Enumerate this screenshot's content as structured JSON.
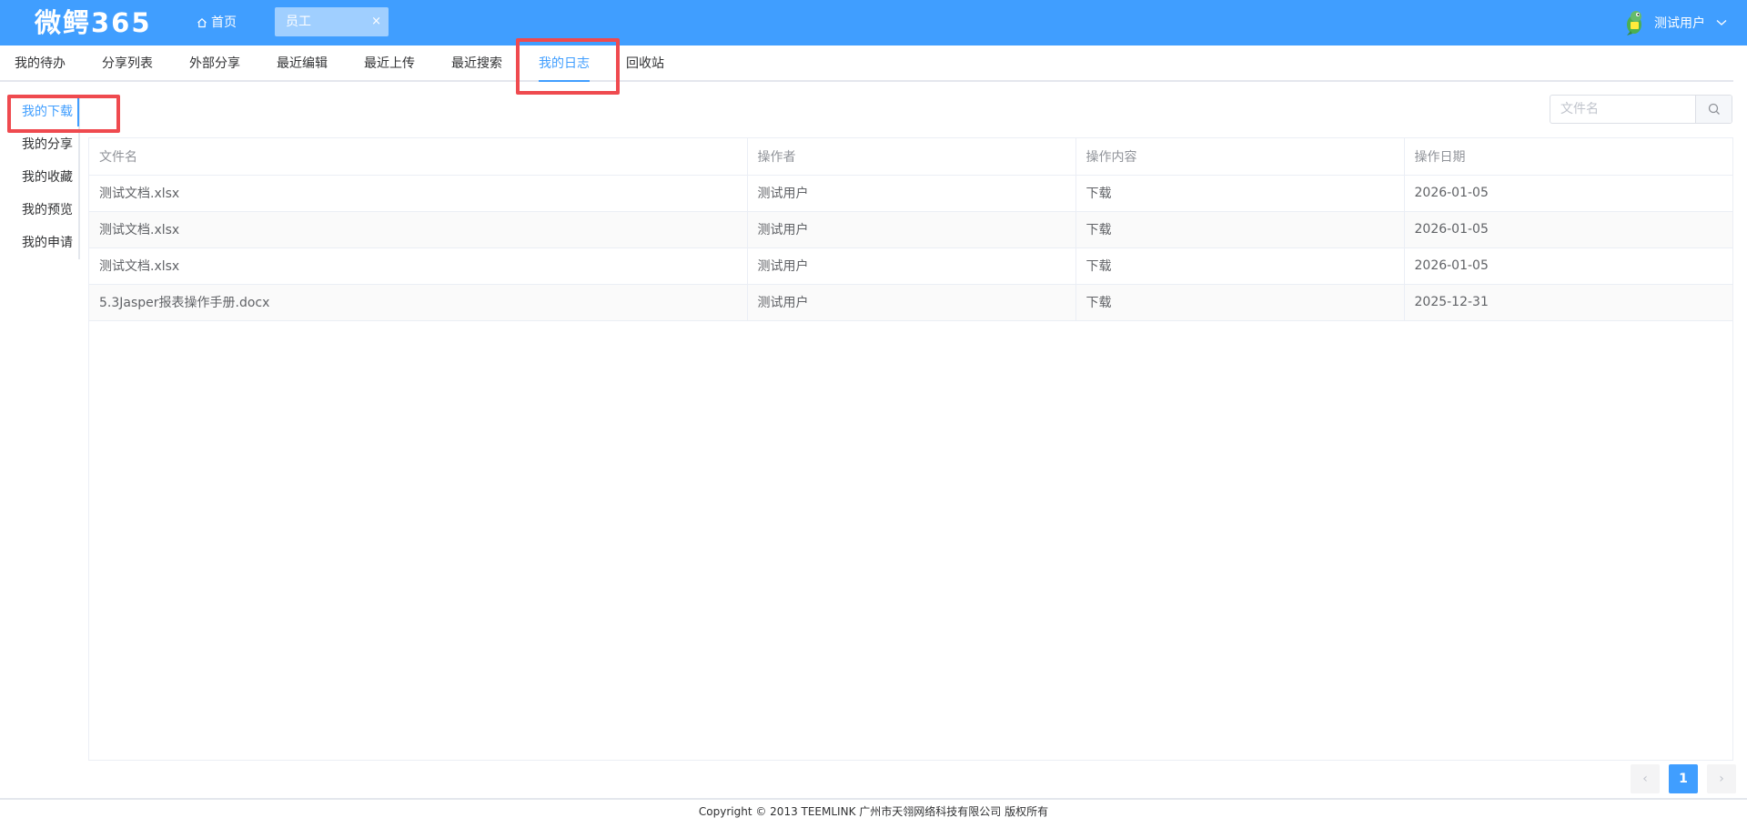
{
  "header": {
    "logo": "微鳄365",
    "home_label": "首页",
    "open_tab": {
      "label": "员工",
      "close": "×"
    },
    "user": {
      "name": "测试用户"
    },
    "bg_color": "#409eff"
  },
  "tabs": [
    {
      "label": "我的待办"
    },
    {
      "label": "分享列表"
    },
    {
      "label": "外部分享"
    },
    {
      "label": "最近编辑"
    },
    {
      "label": "最近上传"
    },
    {
      "label": "最近搜索"
    },
    {
      "label": "我的日志",
      "active": true
    },
    {
      "label": "回收站"
    }
  ],
  "side_menu": [
    {
      "label": "我的下载",
      "active": true
    },
    {
      "label": "我的分享"
    },
    {
      "label": "我的收藏"
    },
    {
      "label": "我的预览"
    },
    {
      "label": "我的申请"
    }
  ],
  "search": {
    "placeholder": "文件名",
    "value": ""
  },
  "table": {
    "columns": [
      "文件名",
      "操作者",
      "操作内容",
      "操作日期"
    ],
    "rows": [
      [
        "测试文档.xlsx",
        "测试用户",
        "下载",
        "2026-01-05"
      ],
      [
        "测试文档.xlsx",
        "测试用户",
        "下载",
        "2026-01-05"
      ],
      [
        "测试文档.xlsx",
        "测试用户",
        "下载",
        "2026-01-05"
      ],
      [
        "5.3Jasper报表操作手册.docx",
        "测试用户",
        "下载",
        "2025-12-31"
      ]
    ]
  },
  "pagination": {
    "current_page": "1",
    "prev": "‹",
    "next": "›"
  },
  "footer": {
    "copyright": "Copyright © 2013 TEEMLINK 广州市天翎网络科技有限公司 版权所有"
  },
  "colors": {
    "accent": "#409eff",
    "highlight": "#ef4a4f"
  }
}
